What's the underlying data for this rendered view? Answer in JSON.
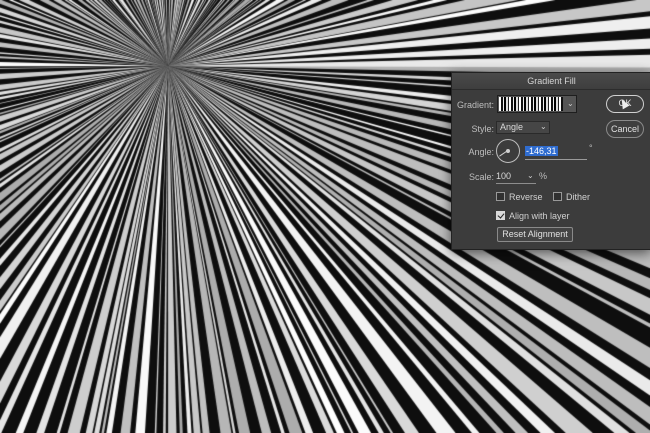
{
  "dialog": {
    "title": "Gradient Fill",
    "gradient_label": "Gradient:",
    "style_label": "Style:",
    "style_value": "Angle",
    "angle_label": "Angle:",
    "angle_value": "-146,31",
    "degree_symbol": "°",
    "scale_label": "Scale:",
    "scale_value": "100",
    "percent_symbol": "%",
    "reverse_label": "Reverse",
    "reverse_checked": false,
    "dither_label": "Dither",
    "dither_checked": false,
    "align_label": "Align with layer",
    "align_checked": true,
    "reset_label": "Reset Alignment",
    "ok_label": "OK",
    "cancel_label": "Cancel"
  },
  "icons": {
    "gradient_dropdown": "chevron-down-icon",
    "style_dropdown": "chevron-down-icon",
    "scale_dropdown": "chevron-down-icon",
    "angle_dial": "angle-dial-icon",
    "pointer": "mouse-pointer-icon"
  },
  "colors": {
    "dialog_bg": "#3c3c3c",
    "selection_highlight": "#2f6ccf",
    "background_dark": "#0e0e0e",
    "ray_light": "#f2f2f2"
  }
}
